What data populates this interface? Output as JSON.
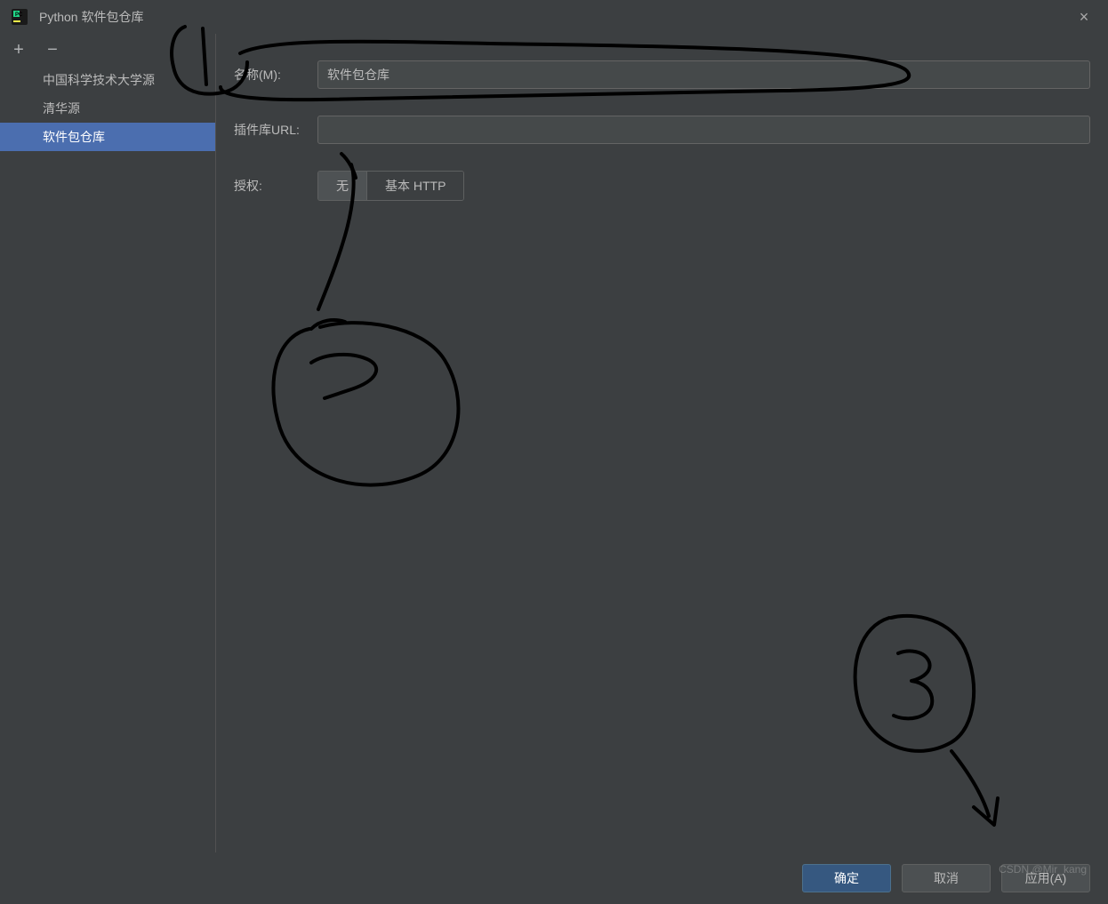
{
  "window": {
    "title": "Python 软件包仓库",
    "close": "×"
  },
  "toolbar": {
    "add": "+",
    "remove": "−"
  },
  "sidebar": {
    "items": [
      {
        "label": "中国科学技术大学源"
      },
      {
        "label": "清华源"
      },
      {
        "label": "软件包仓库"
      }
    ]
  },
  "form": {
    "name_label": "名称(M):",
    "name_value": "软件包仓库",
    "url_label": "插件库URL:",
    "url_value": "",
    "auth_label": "授权:",
    "auth_none": "无",
    "auth_basic": "基本 HTTP"
  },
  "footer": {
    "ok": "确定",
    "cancel": "取消",
    "apply": "应用(A)"
  },
  "watermark": "CSDN @Mir_kang"
}
